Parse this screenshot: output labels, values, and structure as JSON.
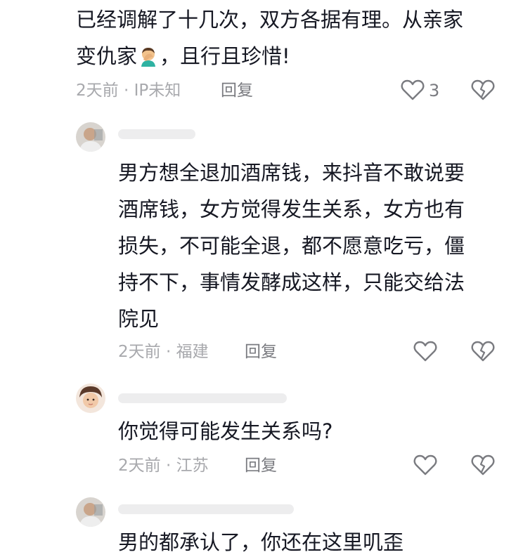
{
  "comments": [
    {
      "lines": [
        "已经调解了十几次，双方各据有理。从亲家",
        "变仇家",
        "，且行且珍惜!"
      ],
      "emoji": "man-facepalming-emoji",
      "time": "2天前",
      "location": "IP未知",
      "reply_label": "回复",
      "like_count": "3"
    },
    {
      "lines": [
        "男方想全退加酒席钱，来抖音不敢说要",
        "酒席钱，女方觉得发生关系，女方也有",
        "损失，不可能全退，都不愿意吃亏，僵",
        "持不下，事情发酵成这样，只能交给法",
        "院见"
      ],
      "time": "2天前",
      "location": "福建",
      "reply_label": "回复"
    },
    {
      "lines": [
        "你觉得可能发生关系吗?"
      ],
      "time": "2天前",
      "location": "江苏",
      "reply_label": "回复"
    },
    {
      "lines": [
        "男的都承认了，你还在这里叽歪"
      ]
    }
  ],
  "meta_separator": "·",
  "icons": {
    "like": "heart-outline-icon",
    "dislike": "broken-heart-icon"
  },
  "colors": {
    "text": "#161823",
    "meta": "#a8a9ad",
    "reply": "#7a7b80"
  }
}
